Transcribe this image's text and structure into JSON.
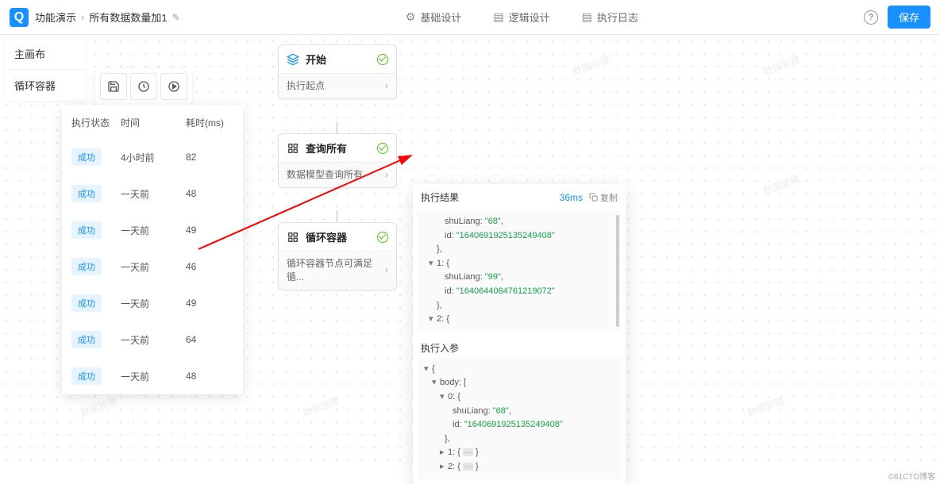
{
  "header": {
    "logo_letter": "Q",
    "breadcrumb": {
      "root": "功能演示",
      "current": "所有数据数量加1"
    },
    "tabs": [
      {
        "label": "基础设计"
      },
      {
        "label": "逻辑设计"
      },
      {
        "label": "执行日志"
      }
    ],
    "save": "保存"
  },
  "left_tabs": [
    "主画布",
    "循环容器"
  ],
  "log_panel": {
    "cols": [
      "执行状态",
      "时间",
      "耗时(ms)"
    ],
    "success_label": "成功",
    "rows": [
      {
        "time": "4小时前",
        "ms": "82"
      },
      {
        "time": "一天前",
        "ms": "48"
      },
      {
        "time": "一天前",
        "ms": "49"
      },
      {
        "time": "一天前",
        "ms": "46"
      },
      {
        "time": "一天前",
        "ms": "49"
      },
      {
        "time": "一天前",
        "ms": "64"
      },
      {
        "time": "一天前",
        "ms": "48"
      }
    ]
  },
  "nodes": {
    "start": {
      "title": "开始",
      "sub": "执行起点"
    },
    "query": {
      "title": "查询所有",
      "sub": "数据模型查询所有"
    },
    "loop": {
      "title": "循环容器",
      "sub": "循环容器节点可满足循..."
    }
  },
  "result": {
    "title": "执行结果",
    "ms": "36ms",
    "copy": "复制",
    "out": {
      "line1_key": "shuLiang:",
      "line1_val": "\"68\"",
      "line2_key": "id:",
      "line2_val": "\"1640691925135249408\"",
      "line3": "},",
      "line4": "1: {",
      "line5_key": "shuLiang:",
      "line5_val": "\"99\"",
      "line6_key": "id:",
      "line6_val": "\"1640644084761219072\"",
      "line7": "},",
      "line8": "2: {"
    },
    "in_title": "执行入参",
    "in": {
      "l1": "{",
      "l2": "body: [",
      "l3": "0: {",
      "l4_key": "shuLiang:",
      "l4_val": "\"68\"",
      "l5_key": "id:",
      "l5_val": "\"1640691925135249408\"",
      "l6": "},",
      "l7a": "1: {",
      "l7b": "}",
      "l8a": "2: {",
      "l8b": "}"
    }
  },
  "watermark": "数据管理",
  "footer": "©61CTO博客"
}
